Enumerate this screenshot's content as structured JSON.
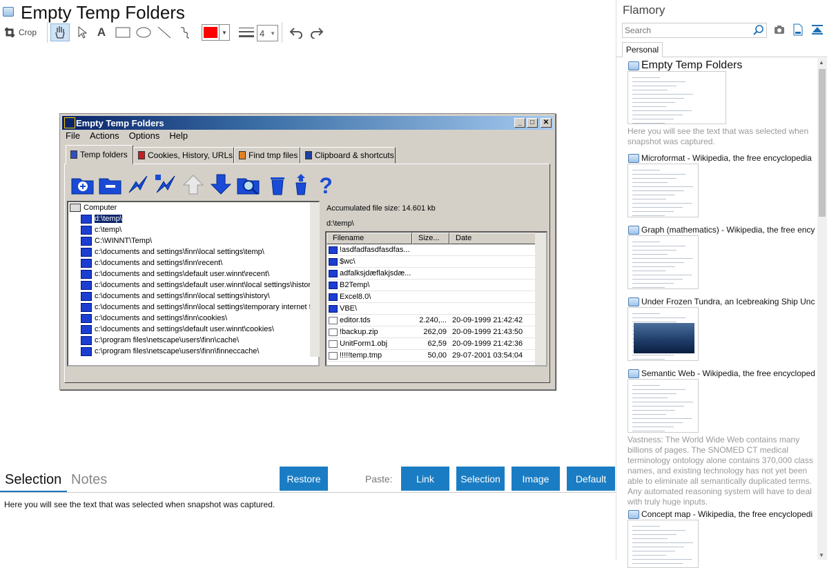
{
  "title": "Empty Temp Folders",
  "toolbar": {
    "crop_label": "Crop",
    "line_width": "4",
    "color": "#ff0000"
  },
  "window": {
    "title": "Empty Temp Folders",
    "menu": [
      "File",
      "Actions",
      "Options",
      "Help"
    ],
    "tabs": [
      "Temp folders",
      "Cookies, History, URLs",
      "Find tmp files",
      "Clipboard & shortcuts"
    ],
    "tree_root": "Computer",
    "tree_items": [
      "d:\\temp\\",
      "c:\\temp\\",
      "C:\\WINNT\\Temp\\",
      "c:\\documents and settings\\finn\\local settings\\temp\\",
      "c:\\documents and settings\\finn\\recent\\",
      "c:\\documents and settings\\default user.winnt\\recent\\",
      "c:\\documents and settings\\default user.winnt\\local settings\\histor",
      "c:\\documents and settings\\finn\\local settings\\history\\",
      "c:\\documents and settings\\finn\\local settings\\temporary internet f",
      "c:\\documents and settings\\finn\\cookies\\",
      "c:\\documents and settings\\default user.winnt\\cookies\\",
      "c:\\program files\\netscape\\users\\finn\\cache\\",
      "c:\\program files\\netscape\\users\\finn\\finneccache\\"
    ],
    "accumulated": "Accumulated file size: 14.601 kb",
    "current_path": "d:\\temp\\",
    "columns": [
      "Filename",
      "Size...",
      "Date"
    ],
    "files": [
      {
        "name": "!asdfadfasdfasdfas...",
        "size": "",
        "date": ""
      },
      {
        "name": "$wc\\",
        "size": "",
        "date": ""
      },
      {
        "name": "adfalksjdæflakjsdæ...",
        "size": "",
        "date": ""
      },
      {
        "name": "B2Temp\\",
        "size": "",
        "date": ""
      },
      {
        "name": "Excel8.0\\",
        "size": "",
        "date": ""
      },
      {
        "name": "VBE\\",
        "size": "",
        "date": ""
      },
      {
        "name": "editor.tds",
        "size": "2.240,...",
        "date": "20-09-1999 21:42:42"
      },
      {
        "name": "!backup.zip",
        "size": "262,09",
        "date": "20-09-1999 21:43:50"
      },
      {
        "name": "UnitForm1.obj",
        "size": "62,59",
        "date": "20-09-1999 21:42:36"
      },
      {
        "name": "!!!!!temp.tmp",
        "size": "50,00",
        "date": "29-07-2001 03:54:04"
      }
    ]
  },
  "bottom": {
    "tab_selection": "Selection",
    "tab_notes": "Notes",
    "restore": "Restore",
    "paste": "Paste:",
    "link": "Link",
    "selection": "Selection",
    "image": "Image",
    "default": "Default",
    "selected_text": "Here you will see the text that was selected when snapshot was captured."
  },
  "sidebar": {
    "app_name": "Flamory",
    "search_placeholder": "Search",
    "tab": "Personal",
    "entries": [
      {
        "title": "Empty Temp Folders",
        "desc": "Here you will see the text that was selected when snapshot was captured."
      },
      {
        "title": "Microformat - Wikipedia, the free encyclopedia",
        "desc": ""
      },
      {
        "title": "Graph (mathematics) - Wikipedia, the free ency",
        "desc": ""
      },
      {
        "title": "Under Frozen Tundra, an Icebreaking Ship Unco",
        "desc": ""
      },
      {
        "title": "Semantic Web - Wikipedia, the free encycloped",
        "desc": "Vastness: The World Wide Web contains many billions of pages. The SNOMED CT medical terminology ontology alone contains 370,000 class names, and existing technology has not yet been able to eliminate all semantically duplicated terms. Any automated reasoning system will have to deal with truly huge inputs."
      },
      {
        "title": "Concept map - Wikipedia, the free encyclopedi",
        "desc": ""
      }
    ]
  }
}
